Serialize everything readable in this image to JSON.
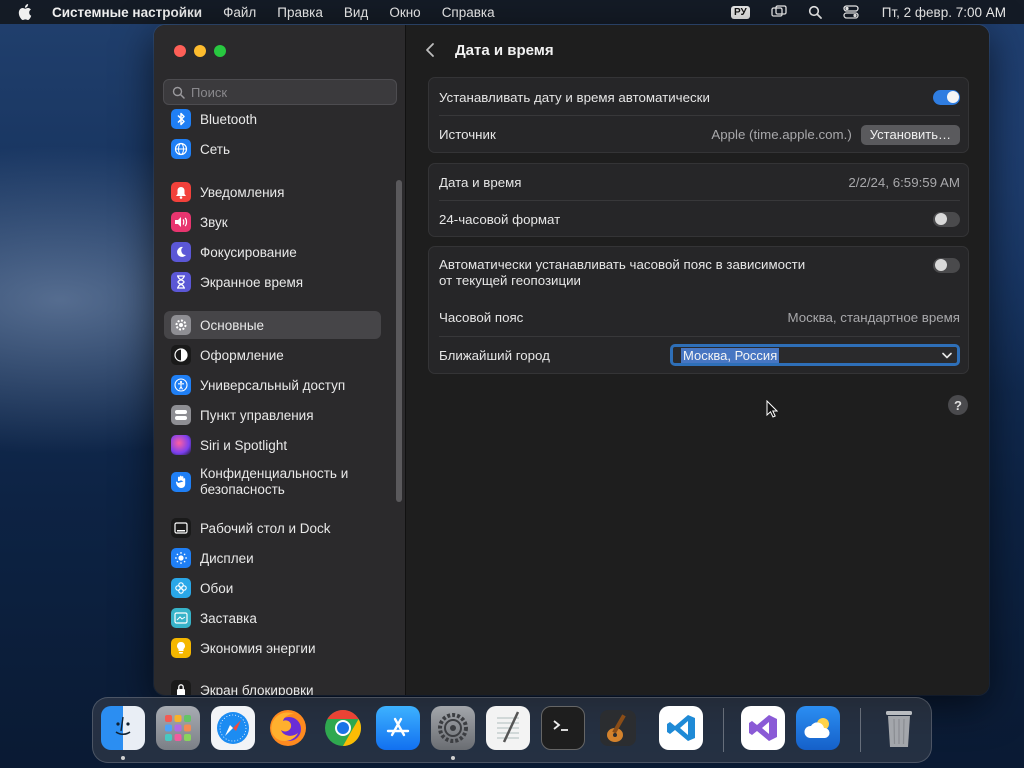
{
  "menubar": {
    "app_name": "Системные настройки",
    "items": [
      "Файл",
      "Правка",
      "Вид",
      "Окно",
      "Справка"
    ],
    "input_language": "РУ",
    "clock": "Пт, 2 февр.  7:00 AM"
  },
  "sidebar": {
    "search_placeholder": "Поиск",
    "items": [
      {
        "label": "Bluetooth",
        "icon": "bluetooth-icon",
        "color": "#1f7ff5"
      },
      {
        "label": "Сеть",
        "icon": "globe-icon",
        "color": "#1f7ff5"
      },
      {
        "label": "Уведомления",
        "icon": "bell-icon",
        "color": "#f2413b"
      },
      {
        "label": "Звук",
        "icon": "speaker-icon",
        "color": "#e8356f"
      },
      {
        "label": "Фокусирование",
        "icon": "moon-icon",
        "color": "#5b57d6"
      },
      {
        "label": "Экранное время",
        "icon": "hourglass-icon",
        "color": "#5b57d6"
      },
      {
        "label": "Основные",
        "icon": "gear-icon",
        "color": "#8e8e93"
      },
      {
        "label": "Оформление",
        "icon": "appearance-icon",
        "color": "#1a1a1a"
      },
      {
        "label": "Универсальный доступ",
        "icon": "accessibility-icon",
        "color": "#1f7ff5"
      },
      {
        "label": "Пункт управления",
        "icon": "control-center-icon",
        "color": "#8e8e93"
      },
      {
        "label": "Siri и Spotlight",
        "icon": "siri-icon",
        "color": "#b94be0"
      },
      {
        "label": "Конфиденциальность и безопасность",
        "icon": "hand-icon",
        "color": "#1f7ff5"
      },
      {
        "label": "Рабочий стол и Dock",
        "icon": "dock-icon",
        "color": "#1a1a1a"
      },
      {
        "label": "Дисплеи",
        "icon": "sun-icon",
        "color": "#1f7ff5"
      },
      {
        "label": "Обои",
        "icon": "wallpaper-icon",
        "color": "#2aa7e8"
      },
      {
        "label": "Заставка",
        "icon": "screensaver-icon",
        "color": "#37b3c9"
      },
      {
        "label": "Экономия энергии",
        "icon": "bulb-icon",
        "color": "#f5b700"
      },
      {
        "label": "Экран блокировки",
        "icon": "lock-icon",
        "color": "#1a1a1a"
      }
    ],
    "selected": "Основные"
  },
  "content": {
    "title": "Дата и время",
    "auto_set_label": "Устанавливать дату и время автоматически",
    "auto_set_on": true,
    "source_label": "Источник",
    "source_value": "Apple (time.apple.com.)",
    "set_button": "Установить…",
    "date_time_label": "Дата и время",
    "date_time_value": "2/2/24, 6:59:59 AM",
    "format24_label": "24-часовой формат",
    "format24_on": false,
    "auto_tz_label_line1": "Автоматически устанавливать часовой пояс в зависимости",
    "auto_tz_label_line2": "от текущей геопозиции",
    "auto_tz_on": false,
    "timezone_label": "Часовой пояс",
    "timezone_value": "Москва, стандартное время",
    "city_label": "Ближайший город",
    "city_value": "Москва, Россия",
    "help": "?"
  },
  "dock": {
    "apps": [
      "Finder",
      "Launchpad",
      "Safari",
      "Firefox",
      "Chrome",
      "App Store",
      "System Settings",
      "TextEdit",
      "Terminal",
      "GarageBand",
      "Visual Studio Code",
      "Visual Studio",
      "Weather",
      "Trash"
    ]
  },
  "colors": {
    "accent": "#2f7de1",
    "window_bg": "#1e1e1e",
    "sidebar_bg": "#2b2a2c"
  }
}
